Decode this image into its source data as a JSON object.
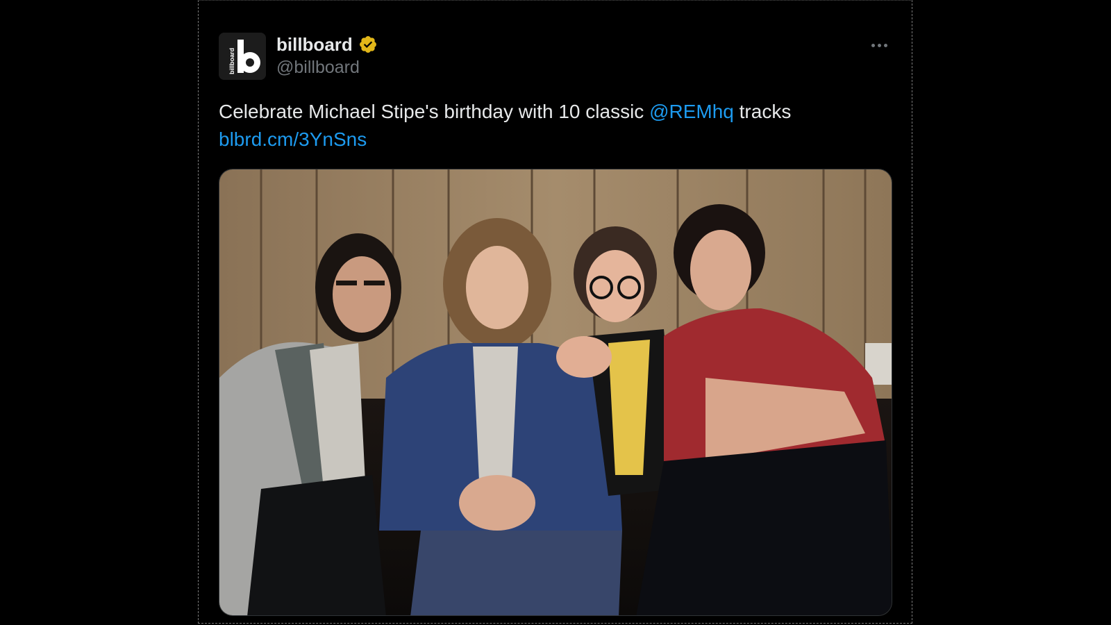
{
  "account": {
    "display_name": "billboard",
    "handle": "@billboard",
    "verified": true,
    "verified_color": "#e2b719",
    "avatar_icon": "billboard-logo-icon",
    "avatar_logo_text": "billboard"
  },
  "tweet": {
    "text_before_mention": "Celebrate Michael Stipe's birthday with 10 classic ",
    "mention": "@REMhq",
    "text_after_mention": " tracks",
    "link": "blbrd.cm/3YnSns",
    "link_color": "#1d9bf0"
  },
  "menu": {
    "more_icon": "more-horizontal-icon"
  },
  "media": {
    "type": "photo"
  }
}
